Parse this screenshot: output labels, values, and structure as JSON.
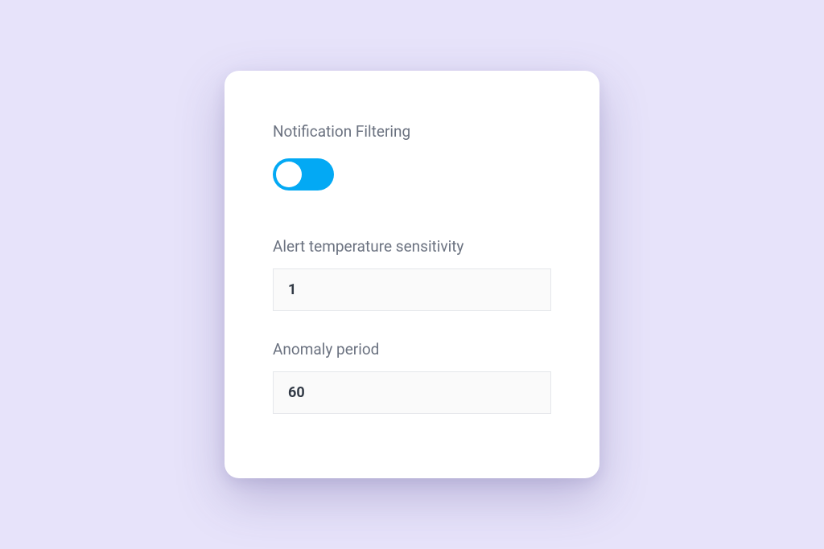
{
  "section": {
    "title": "Notification Filtering",
    "toggle_on": true
  },
  "fields": {
    "sensitivity": {
      "label": "Alert temperature sensitivity",
      "value": "1"
    },
    "anomaly": {
      "label": "Anomaly period",
      "value": "60"
    }
  }
}
